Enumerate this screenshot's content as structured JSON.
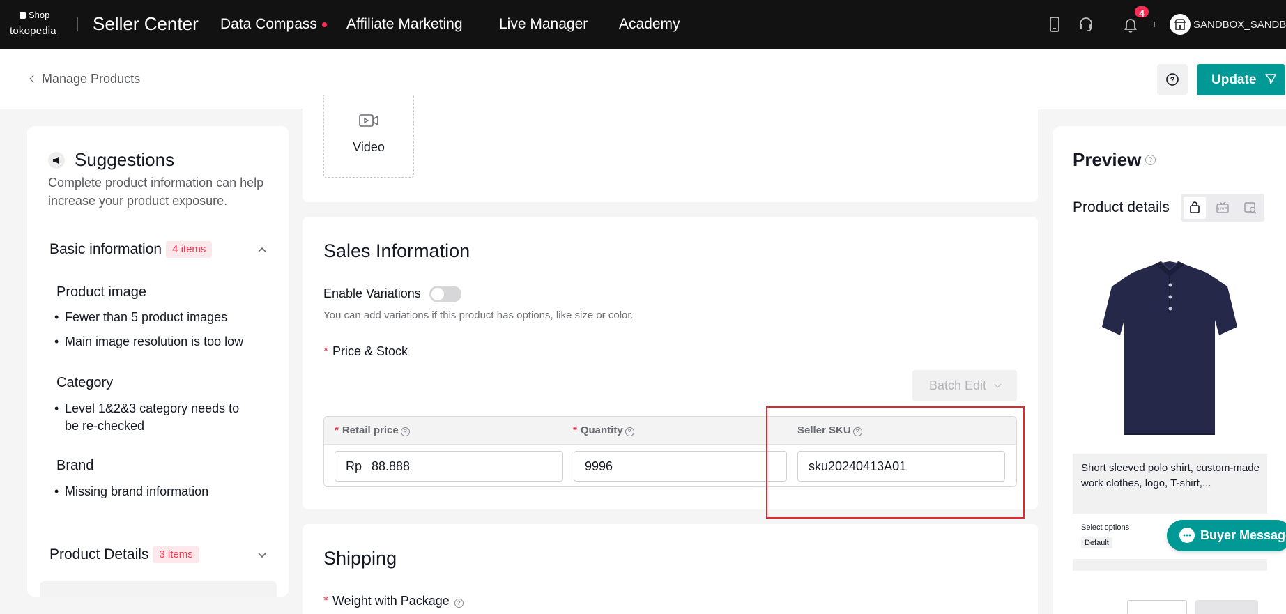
{
  "topnav": {
    "brand_shop": "Shop",
    "brand_tokopedia": "tokopedia",
    "title": "Seller Center",
    "links": [
      "Data Compass",
      "Affiliate Marketing",
      "Live Manager",
      "Academy"
    ],
    "notification_count": "4",
    "user_name": "SANDBOX_SANDBOX"
  },
  "subheader": {
    "back_label": "Manage Products",
    "help_icon": "question-circle-icon",
    "update_label": "Update"
  },
  "suggestions": {
    "title": "Suggestions",
    "description": "Complete product information can help increase your product exposure.",
    "basic": {
      "label": "Basic information",
      "count": "4 items",
      "groups": [
        {
          "title": "Product image",
          "items": [
            "Fewer than 5 product images",
            "Main image resolution is too low"
          ]
        },
        {
          "title": "Category",
          "items": [
            "Level 1&2&3 category needs to be re-checked"
          ]
        },
        {
          "title": "Brand",
          "items": [
            "Missing brand information"
          ]
        }
      ]
    },
    "details": {
      "label": "Product Details",
      "count": "3 items"
    }
  },
  "media": {
    "video_label": "Video"
  },
  "sales": {
    "title": "Sales Information",
    "variations_label": "Enable Variations",
    "variations_hint": "You can add variations if this product has options, like size or color.",
    "price_stock_label": "Price & Stock",
    "batch_edit_label": "Batch Edit",
    "columns": [
      "Retail price",
      "Quantity",
      "Seller SKU"
    ],
    "currency_prefix": "Rp",
    "price_value": "88.888",
    "quantity_value": "9996",
    "sku_value": "sku20240413A01"
  },
  "shipping": {
    "title": "Shipping",
    "weight_label": "Weight with Package"
  },
  "preview": {
    "title": "Preview",
    "details_label": "Product details",
    "product_name": "Short sleeved polo shirt, custom-made work clothes, logo, T-shirt,...",
    "select_options": "Select options",
    "default_option": "Default",
    "buyer_message": "Buyer Message"
  },
  "colors": {
    "accent": "#009995",
    "tag_red": "#f5354e",
    "highlight_box": "#e3262f",
    "nav_bg": "#121212"
  }
}
